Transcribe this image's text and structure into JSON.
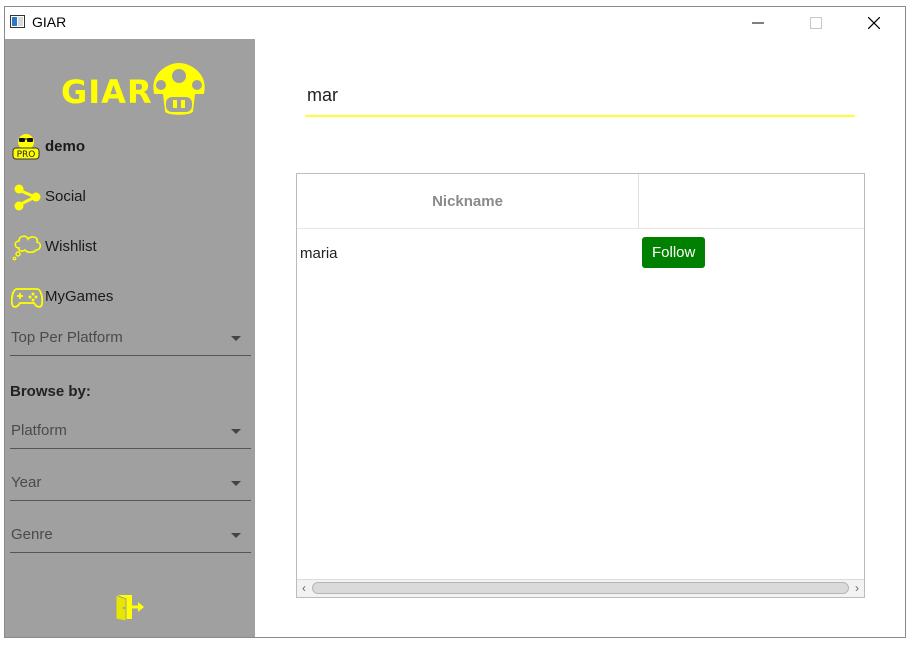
{
  "window": {
    "title": "GIAR"
  },
  "sidebar": {
    "logo_text": "GIAR",
    "user": {
      "name": "demo",
      "badge": "PRO"
    },
    "nav": [
      {
        "label": "Social",
        "icon": "share-icon"
      },
      {
        "label": "Wishlist",
        "icon": "thought-bubble-icon"
      },
      {
        "label": "MyGames",
        "icon": "gamepad-icon"
      }
    ],
    "top_select": {
      "value": "Top Per Platform"
    },
    "browse_label": "Browse by:",
    "browse_selects": [
      {
        "value": "Platform"
      },
      {
        "value": "Year"
      },
      {
        "value": "Genre"
      }
    ],
    "accent_color": "#ffff00",
    "background_color": "#a0a0a0"
  },
  "search": {
    "value": "mar"
  },
  "table": {
    "columns": [
      "Nickname",
      ""
    ],
    "rows": [
      {
        "nickname": "maria",
        "action": "Follow"
      }
    ],
    "follow_color": "#008000"
  }
}
